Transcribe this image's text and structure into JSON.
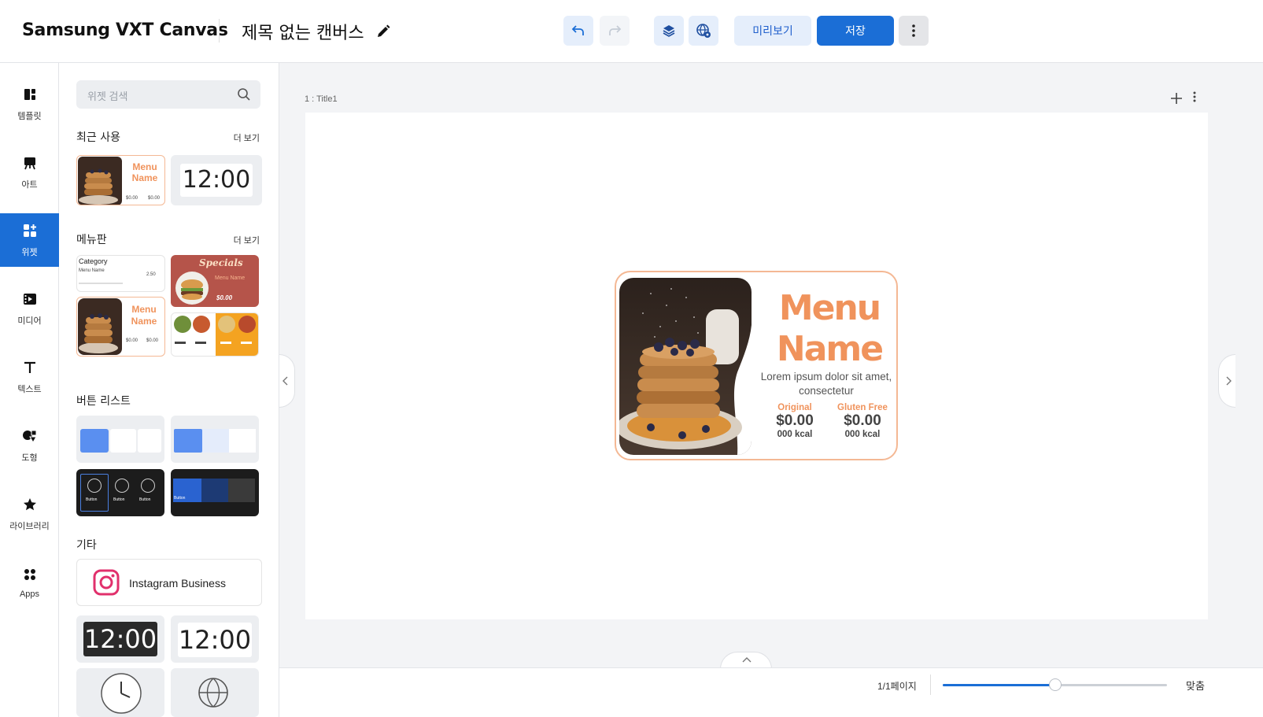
{
  "app": {
    "brand": "Samsung VXT Canvas",
    "doc_title": "제목 없는 캔버스"
  },
  "toolbar": {
    "preview_label": "미리보기",
    "save_label": "저장"
  },
  "rail": {
    "items": [
      {
        "label": "템플릿",
        "icon": "template-icon"
      },
      {
        "label": "아트",
        "icon": "art-easel-icon"
      },
      {
        "label": "위젯",
        "icon": "widget-icon",
        "active": true
      },
      {
        "label": "미디어",
        "icon": "media-icon"
      },
      {
        "label": "텍스트",
        "icon": "text-icon"
      },
      {
        "label": "도형",
        "icon": "shape-icon"
      },
      {
        "label": "라이브러리",
        "icon": "star-icon"
      },
      {
        "label": "Apps",
        "icon": "apps-icon"
      }
    ]
  },
  "panel": {
    "search_placeholder": "위젯 검색",
    "more_label": "더 보기",
    "sections": {
      "recent": "최근 사용",
      "menu": "메뉴판",
      "buttons": "버튼 리스트",
      "etc": "기타"
    },
    "recent_thumbs": {
      "menu_line1": "Menu",
      "menu_line2": "Name",
      "price_a": "$0.00",
      "price_b": "$0.00",
      "clock": "12:00"
    },
    "menu_thumbs": {
      "category": "Category",
      "item": "Menu Name",
      "price": "2.50",
      "specials": "Specials",
      "specials_item": "Menu Name",
      "specials_price": "$0.00",
      "menu_line1": "Menu",
      "menu_line2": "Name",
      "price_a": "$0.00",
      "price_b": "$0.00"
    },
    "button_thumbs": {
      "btn": "Button"
    },
    "instagram_label": "Instagram Business",
    "clock_dark": "12:00",
    "clock_light": "12:00"
  },
  "canvas": {
    "page_label": "1 : Title1",
    "widget": {
      "name_line1": "Menu",
      "name_line2": "Name",
      "description": "Lorem ipsum dolor sit amet, consectetur",
      "prices": [
        {
          "label": "Original",
          "amount": "$0.00",
          "kcal": "000 kcal"
        },
        {
          "label": "Gluten Free",
          "amount": "$0.00",
          "kcal": "000 kcal"
        }
      ]
    }
  },
  "bottombar": {
    "page_info": "1/1페이지",
    "zoom_fraction": 0.5,
    "fit_label": "맞춤"
  },
  "colors": {
    "accent": "#1b6ed6",
    "menu_orange": "#f0935c",
    "specials_red": "#b5544a"
  }
}
